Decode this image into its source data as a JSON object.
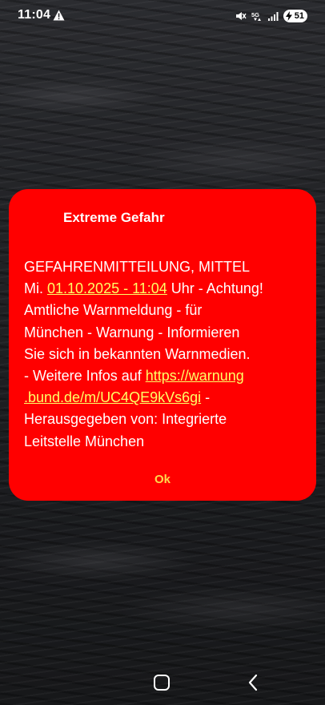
{
  "status_bar": {
    "time": "11:04",
    "icons": [
      "alert-triangle-icon",
      "mute-icon",
      "5g-icon",
      "signal-icon",
      "battery-icon"
    ],
    "network": "5G",
    "battery": "51"
  },
  "dialog": {
    "title": "Extreme Gefahr",
    "body": {
      "line1": "GEFAHRENMITTEILUNG, MITTEL",
      "prefix2": "Mi. ",
      "date_link": "01.10.2025 - 11:04",
      "after_date": " Uhr - Achtung!\nAmtliche Warnmeldung - für\nMünchen - Warnung - Informieren\nSie sich in bekannten Warnmedien.\n- Weitere Infos auf ",
      "url_link_1": "https://warnung",
      "url_link_2": ".bund.de/m/UC4QE9kVs6gi",
      "after_url": " -\nHerausgegeben von: Integrierte\nLeitstelle München"
    },
    "ok_label": "Ok",
    "background_color": "#ff0000",
    "link_color": "#ffff66",
    "button_color": "#ffd84d"
  },
  "nav_bar": {
    "icons": [
      "home-icon",
      "back-icon"
    ]
  }
}
